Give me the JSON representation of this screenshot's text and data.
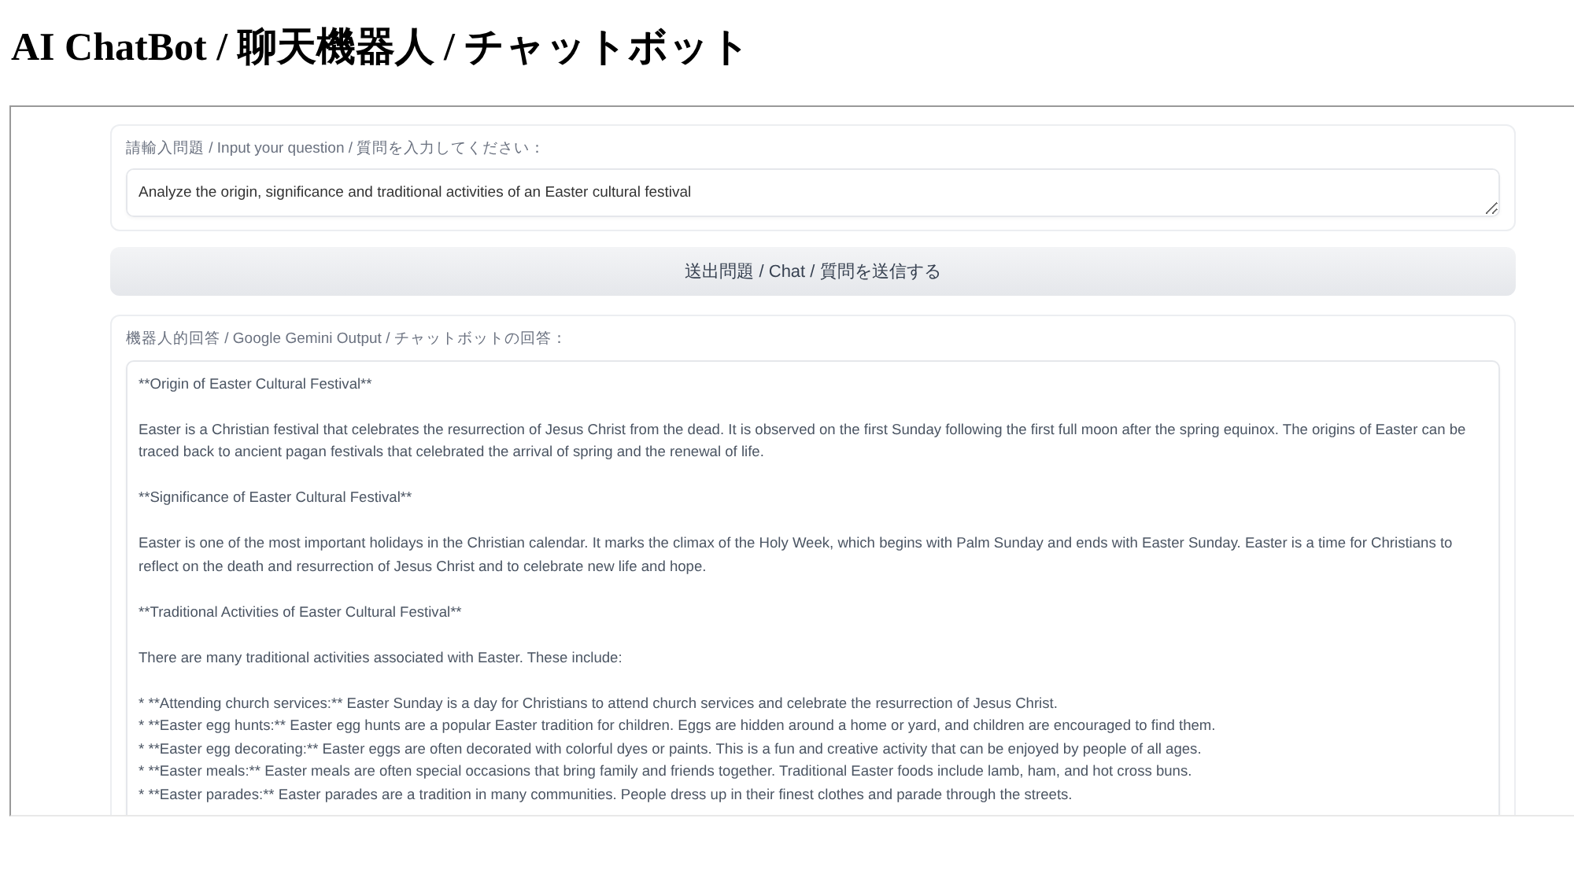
{
  "title": "AI ChatBot / 聊天機器人 / チャットボット",
  "question": {
    "label": "請輸入問題 / Input your question / 質問を入力してください：",
    "value": "Analyze the origin, significance and traditional activities of an Easter cultural festival"
  },
  "submit_button": "送出問題 / Chat / 質問を送信する",
  "output": {
    "label": "機器人的回答 / Google Gemini Output / チャットボットの回答：",
    "blocks": [
      {
        "lines": [
          "**Origin of Easter Cultural Festival**"
        ]
      },
      {
        "lines": [
          "Easter is a Christian festival that celebrates the resurrection of Jesus Christ from the dead. It is observed on the first Sunday following the first full moon after the spring equinox. The origins of Easter can be traced back to ancient pagan festivals that celebrated the arrival of spring and the renewal of life."
        ]
      },
      {
        "lines": [
          "**Significance of Easter Cultural Festival**"
        ]
      },
      {
        "lines": [
          "Easter is one of the most important holidays in the Christian calendar. It marks the climax of the Holy Week, which begins with Palm Sunday and ends with Easter Sunday. Easter is a time for Christians to reflect on the death and resurrection of Jesus Christ and to celebrate new life and hope."
        ]
      },
      {
        "lines": [
          "**Traditional Activities of Easter Cultural Festival**"
        ]
      },
      {
        "lines": [
          "There are many traditional activities associated with Easter. These include:"
        ]
      },
      {
        "lines": [
          "* **Attending church services:** Easter Sunday is a day for Christians to attend church services and celebrate the resurrection of Jesus Christ.",
          "* **Easter egg hunts:** Easter egg hunts are a popular Easter tradition for children. Eggs are hidden around a home or yard, and children are encouraged to find them.",
          "* **Easter egg decorating:** Easter eggs are often decorated with colorful dyes or paints. This is a fun and creative activity that can be enjoyed by people of all ages.",
          "* **Easter meals:** Easter meals are often special occasions that bring family and friends together. Traditional Easter foods include lamb, ham, and hot cross buns.",
          "* **Easter parades:** Easter parades are a tradition in many communities. People dress up in their finest clothes and parade through the streets."
        ]
      }
    ]
  }
}
